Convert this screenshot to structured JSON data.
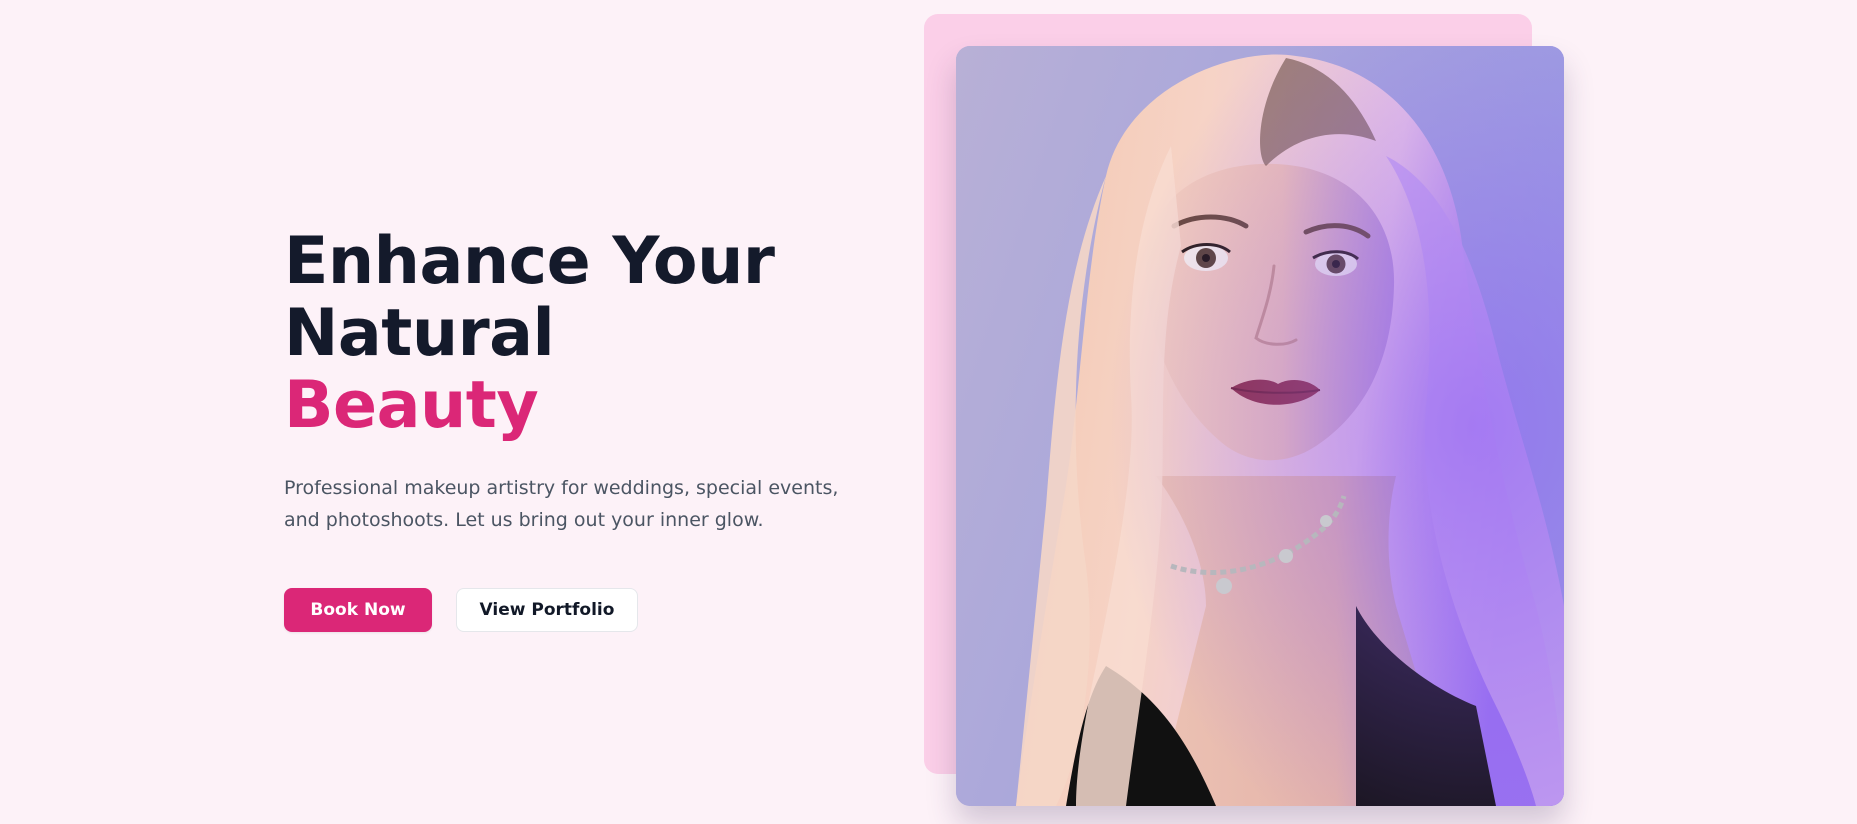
{
  "hero": {
    "headline_line1": "Enhance Your",
    "headline_line2": "Natural",
    "headline_accent": "Beauty",
    "subtitle": "Professional makeup artistry for weddings, special events, and photoshoots. Let us bring out your inner glow.",
    "primary_button": "Book Now",
    "secondary_button": "View Portfolio"
  },
  "image": {
    "alt": "Portrait of a woman with long pink-blonde hair"
  },
  "colors": {
    "background": "#fdf2f8",
    "heading": "#141a2b",
    "accent": "#db2777",
    "body_text": "#4b5563",
    "backdrop": "#fbcfe8"
  }
}
